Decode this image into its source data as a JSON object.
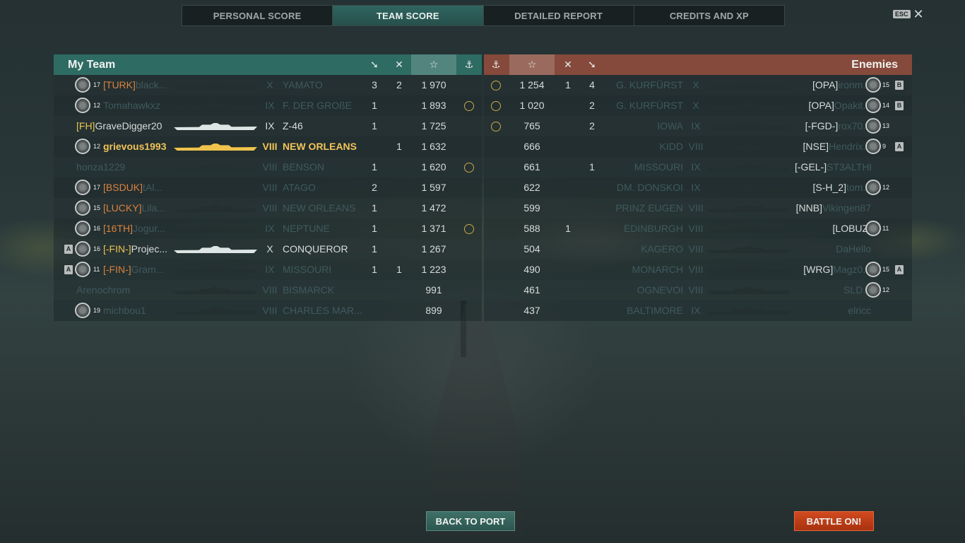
{
  "tabs": [
    {
      "label": "PERSONAL SCORE",
      "active": false
    },
    {
      "label": "TEAM SCORE",
      "active": true
    },
    {
      "label": "DETAILED REPORT",
      "active": false
    },
    {
      "label": "CREDITS AND XP",
      "active": false
    }
  ],
  "esc_label": "ESC",
  "my_team": {
    "title": "My Team",
    "players": [
      {
        "rank": "17",
        "clan": "[TURK]",
        "name": "black...",
        "tier": "X",
        "ship": "YAMATO",
        "kills": "3",
        "planes": "2",
        "score": "1 970",
        "anchor": false,
        "style": "dim"
      },
      {
        "rank": "12",
        "clan": "",
        "name": "Tomahawkxz",
        "tier": "IX",
        "ship": "F. DER GROßE",
        "kills": "1",
        "planes": "",
        "score": "1 893",
        "anchor": true,
        "style": "dim"
      },
      {
        "rank": "",
        "clan": "[FH]",
        "name": "GraveDigger20",
        "tier": "IX",
        "ship": "Z-46",
        "kills": "1",
        "planes": "",
        "score": "1 725",
        "anchor": false,
        "style": "alive"
      },
      {
        "rank": "12",
        "clan": "",
        "name": "grievous1993",
        "tier": "VIII",
        "ship": "NEW ORLEANS",
        "kills": "",
        "planes": "1",
        "score": "1 632",
        "anchor": false,
        "style": "me"
      },
      {
        "rank": "",
        "clan": "",
        "name": "honza1229",
        "tier": "VIII",
        "ship": "BENSON",
        "kills": "1",
        "planes": "",
        "score": "1 620",
        "anchor": true,
        "style": "dim"
      },
      {
        "rank": "17",
        "clan": "[BSDUK]",
        "name": "tAl...",
        "tier": "VIII",
        "ship": "ATAGO",
        "kills": "2",
        "planes": "",
        "score": "1 597",
        "anchor": false,
        "style": "dim"
      },
      {
        "rank": "15",
        "clan": "[LUCKY]",
        "name": "Lila...",
        "tier": "VIII",
        "ship": "NEW ORLEANS",
        "kills": "1",
        "planes": "",
        "score": "1 472",
        "anchor": false,
        "style": "dim"
      },
      {
        "rank": "16",
        "clan": "[16TH]",
        "name": "Jogur...",
        "tier": "IX",
        "ship": "NEPTUNE",
        "kills": "1",
        "planes": "",
        "score": "1 371",
        "anchor": true,
        "style": "dim"
      },
      {
        "rank": "16",
        "clan": "[-FIN-]",
        "name": "Projec...",
        "tier": "X",
        "ship": "CONQUEROR",
        "kills": "1",
        "planes": "",
        "score": "1 267",
        "anchor": false,
        "style": "alive",
        "badge": "A"
      },
      {
        "rank": "11",
        "clan": "[-FIN-]",
        "name": "Gram...",
        "tier": "IX",
        "ship": "MISSOURI",
        "kills": "1",
        "planes": "1",
        "score": "1 223",
        "anchor": false,
        "style": "dim",
        "badge": "A"
      },
      {
        "rank": "",
        "clan": "",
        "name": "Arenochrom",
        "tier": "VIII",
        "ship": "BISMARCK",
        "kills": "",
        "planes": "",
        "score": "991",
        "anchor": false,
        "style": "dim"
      },
      {
        "rank": "19",
        "clan": "",
        "name": "michbou1",
        "tier": "VIII",
        "ship": "CHARLES MAR...",
        "kills": "",
        "planes": "",
        "score": "899",
        "anchor": false,
        "style": "dim"
      }
    ]
  },
  "enemies": {
    "title": "Enemies",
    "players": [
      {
        "anchor": true,
        "score": "1 254",
        "planes": "1",
        "kills": "4",
        "ship": "G. KURFÜRST",
        "tier": "X",
        "clan": "[OPA]",
        "name": "ironm...",
        "rank": "15",
        "badge": "B"
      },
      {
        "anchor": true,
        "score": "1 020",
        "planes": "",
        "kills": "2",
        "ship": "G. KURFÜRST",
        "tier": "X",
        "clan": "[OPA]",
        "name": "Opakit...",
        "rank": "14",
        "badge": "B"
      },
      {
        "anchor": true,
        "score": "765",
        "planes": "",
        "kills": "2",
        "ship": "IOWA",
        "tier": "IX",
        "clan": "[-FGD-]",
        "name": "rox70...",
        "rank": "13",
        "badge": ""
      },
      {
        "anchor": false,
        "score": "666",
        "planes": "",
        "kills": "",
        "ship": "KIDD",
        "tier": "VIII",
        "clan": "[NSE]",
        "name": "Hendrix...",
        "rank": "9",
        "badge": "A"
      },
      {
        "anchor": false,
        "score": "661",
        "planes": "",
        "kills": "1",
        "ship": "MISSOURI",
        "tier": "IX",
        "clan": "[-GEL-]",
        "name": "ST3ALTHP...",
        "rank": "",
        "badge": ""
      },
      {
        "anchor": false,
        "score": "622",
        "planes": "",
        "kills": "",
        "ship": "DM. DONSKOI",
        "tier": "IX",
        "clan": "[S-H_2]",
        "name": "tom...",
        "rank": "12",
        "badge": ""
      },
      {
        "anchor": false,
        "score": "599",
        "planes": "",
        "kills": "",
        "ship": "PRINZ EUGEN",
        "tier": "VIII",
        "clan": "[NNB]",
        "name": "Vikingen87",
        "rank": "",
        "badge": ""
      },
      {
        "anchor": false,
        "score": "588",
        "planes": "1",
        "kills": "",
        "ship": "EDINBURGH",
        "tier": "VIII",
        "clan": "[LOBUZ]",
        "name": "",
        "rank": "11",
        "badge": ""
      },
      {
        "anchor": false,
        "score": "504",
        "planes": "",
        "kills": "",
        "ship": "KAGERO",
        "tier": "VIII",
        "clan": "",
        "name": "DaHello",
        "rank": "",
        "badge": ""
      },
      {
        "anchor": false,
        "score": "490",
        "planes": "",
        "kills": "",
        "ship": "MONARCH",
        "tier": "VIII",
        "clan": "[WRG]",
        "name": "Magz0...",
        "rank": "15",
        "badge": "A"
      },
      {
        "anchor": false,
        "score": "461",
        "planes": "",
        "kills": "",
        "ship": "OGNEVOI",
        "tier": "VIII",
        "clan": "",
        "name": "SLD...",
        "rank": "12",
        "badge": ""
      },
      {
        "anchor": false,
        "score": "437",
        "planes": "",
        "kills": "",
        "ship": "BALTIMORE",
        "tier": "IX",
        "clan": "",
        "name": "elricc",
        "rank": "",
        "badge": ""
      }
    ]
  },
  "header_icons": {
    "kills": "torpedo-icon",
    "planes": "crossed-planes-icon",
    "score": "star-icon",
    "anchor": "anchor-medal-icon"
  },
  "buttons": {
    "back_to_port": "BACK TO PORT",
    "battle_on": "BATTLE ON!"
  },
  "colors": {
    "my_team_header": "#2e6b63",
    "enemy_header": "#854a3b",
    "player_highlight": "#f2c45a",
    "battle_button": "#c8401a"
  }
}
